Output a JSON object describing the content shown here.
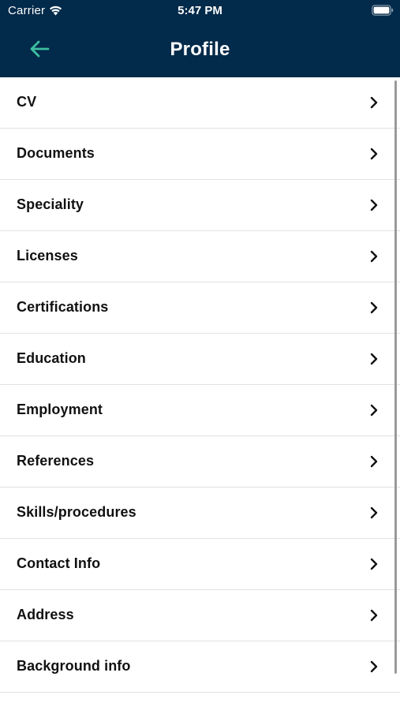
{
  "status_bar": {
    "carrier": "Carrier",
    "time": "5:47 PM",
    "wifi_icon": "wifi-icon",
    "battery_icon": "battery-icon"
  },
  "colors": {
    "header_background": "#022a4a",
    "back_arrow": "#3dbfa0",
    "title_text": "#ffffff",
    "item_text": "#111111",
    "divider": "#e2e2e2"
  },
  "header": {
    "title": "Profile",
    "back_icon": "arrow-left-icon"
  },
  "menu": {
    "items": [
      {
        "label": "CV"
      },
      {
        "label": "Documents"
      },
      {
        "label": "Speciality"
      },
      {
        "label": "Licenses"
      },
      {
        "label": "Certifications"
      },
      {
        "label": "Education"
      },
      {
        "label": "Employment"
      },
      {
        "label": "References"
      },
      {
        "label": "Skills/procedures"
      },
      {
        "label": "Contact Info"
      },
      {
        "label": "Address"
      },
      {
        "label": "Background info"
      }
    ],
    "item_icon": "chevron-right-icon"
  }
}
